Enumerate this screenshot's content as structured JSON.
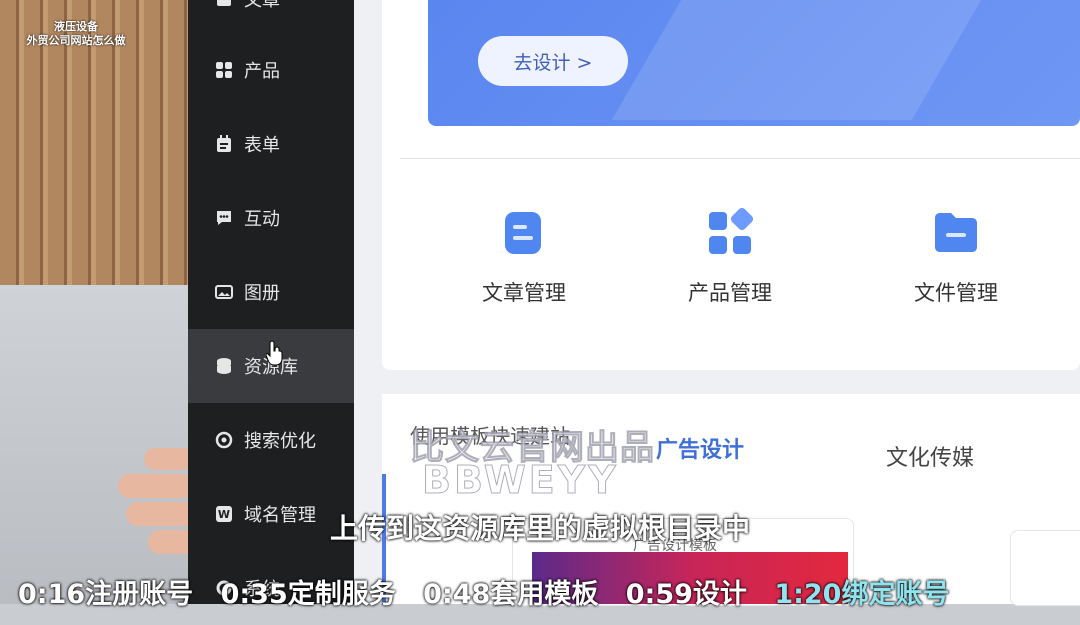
{
  "overlay": {
    "line1": "液压设备",
    "line2": "外贸公司网站怎么做"
  },
  "sidebar": {
    "items": [
      {
        "label": "文章",
        "icon": "article-icon"
      },
      {
        "label": "产品",
        "icon": "grid-icon"
      },
      {
        "label": "表单",
        "icon": "form-icon"
      },
      {
        "label": "互动",
        "icon": "chat-icon"
      },
      {
        "label": "图册",
        "icon": "album-icon"
      },
      {
        "label": "资源库",
        "icon": "database-icon",
        "active": true
      },
      {
        "label": "搜索优化",
        "icon": "seo-icon"
      },
      {
        "label": "域名管理",
        "icon": "domain-icon"
      },
      {
        "label": "系统",
        "icon": "system-icon"
      }
    ]
  },
  "banner": {
    "button_label": "去设计 >"
  },
  "management": [
    {
      "label": "文章管理",
      "icon": "article-manage-icon"
    },
    {
      "label": "产品管理",
      "icon": "product-manage-icon"
    },
    {
      "label": "文件管理",
      "icon": "file-manage-icon"
    }
  ],
  "templates": {
    "section_label": "使用模板快速建站",
    "tabs": [
      "广告设计",
      "文化传媒"
    ],
    "card_caption": "广告设计模板"
  },
  "watermark": {
    "line1": "比文云官网出品",
    "line2": "BBWEYY"
  },
  "subtitle": "上传到这资源库里的虚拟根目录中",
  "timeline": [
    "0:16注册账号",
    "0:35定制服务",
    "0:48套用模板",
    "0:59设计",
    "1:20绑定账号"
  ],
  "colors": {
    "accent": "#4e79e8",
    "sidebar_bg": "#1e1f21",
    "highlight": "#8fe4f0"
  }
}
